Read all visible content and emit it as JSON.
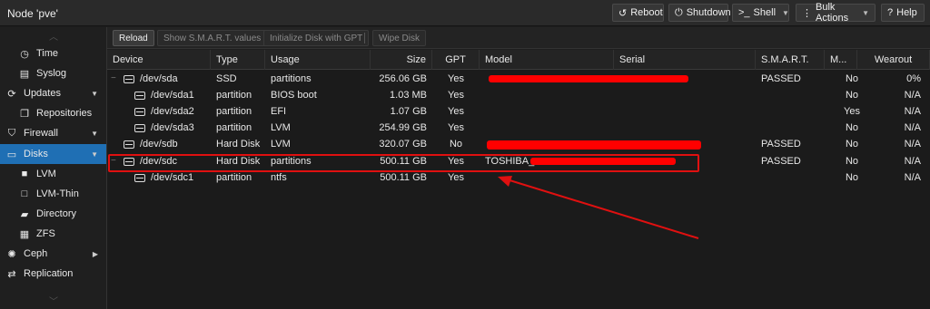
{
  "titlebar": {
    "title": "Node 'pve'",
    "buttons": [
      {
        "label": "Reboot",
        "icon": "reload-icon",
        "glyph": "↺",
        "dropdown": false
      },
      {
        "label": "Shutdown",
        "icon": "power-icon",
        "glyph": "⏻",
        "dropdown": false
      },
      {
        "label": "Shell",
        "icon": "terminal-icon",
        "glyph": ">_",
        "dropdown": true
      },
      {
        "label": "Bulk Actions",
        "icon": "list-icon",
        "glyph": "⋮",
        "dropdown": true
      },
      {
        "label": "Help",
        "icon": "help-icon",
        "glyph": "?",
        "dropdown": false
      }
    ]
  },
  "sidebar": {
    "items": [
      {
        "label": "Time",
        "icon": "clock-icon",
        "glyph": "◷",
        "indent": 1,
        "selected": false,
        "expander": false
      },
      {
        "label": "Syslog",
        "icon": "list-icon",
        "glyph": "▤",
        "indent": 1,
        "selected": false,
        "expander": false
      },
      {
        "label": "Updates",
        "icon": "refresh-icon",
        "glyph": "⟳",
        "indent": 0,
        "selected": false,
        "expander": true
      },
      {
        "label": "Repositories",
        "icon": "files-icon",
        "glyph": "❐",
        "indent": 1,
        "selected": false,
        "expander": false
      },
      {
        "label": "Firewall",
        "icon": "shield-icon",
        "glyph": "⛉",
        "indent": 0,
        "selected": false,
        "expander": true
      },
      {
        "label": "Disks",
        "icon": "disk-icon",
        "glyph": "▭",
        "indent": 0,
        "selected": true,
        "expander": true
      },
      {
        "label": "LVM",
        "icon": "square-icon",
        "glyph": "■",
        "indent": 1,
        "selected": false,
        "expander": false
      },
      {
        "label": "LVM-Thin",
        "icon": "square-outline-icon",
        "glyph": "□",
        "indent": 1,
        "selected": false,
        "expander": false
      },
      {
        "label": "Directory",
        "icon": "folder-icon",
        "glyph": "▰",
        "indent": 1,
        "selected": false,
        "expander": false
      },
      {
        "label": "ZFS",
        "icon": "database-icon",
        "glyph": "▦",
        "indent": 1,
        "selected": false,
        "expander": false
      },
      {
        "label": "Ceph",
        "icon": "ceph-icon",
        "glyph": "✺",
        "indent": 0,
        "selected": false,
        "expander": true
      },
      {
        "label": "Replication",
        "icon": "replication-icon",
        "glyph": "⇄",
        "indent": 0,
        "selected": false,
        "expander": false
      }
    ]
  },
  "toolbar": {
    "buttons": [
      {
        "label": "Reload",
        "enabled": true
      },
      {
        "label": "Show S.M.A.R.T. values",
        "enabled": false
      },
      {
        "label": "Initialize Disk with GPT",
        "enabled": false
      },
      {
        "label": "Wipe Disk",
        "enabled": false
      }
    ]
  },
  "table": {
    "columns": [
      "Device",
      "Type",
      "Usage",
      "Size",
      "GPT",
      "Model",
      "Serial",
      "S.M.A.R.T.",
      "M...",
      "Wearout"
    ],
    "rows": [
      {
        "device": "/dev/sda",
        "level": 0,
        "tree": "−",
        "type": "SSD",
        "usage": "partitions",
        "size": "256.06 GB",
        "gpt": "Yes",
        "model": "",
        "serial": "",
        "smart": "PASSED",
        "mounted": "No",
        "wearout": "0%"
      },
      {
        "device": "/dev/sda1",
        "level": 1,
        "tree": "",
        "type": "partition",
        "usage": "BIOS boot",
        "size": "1.03 MB",
        "gpt": "Yes",
        "model": "",
        "serial": "",
        "smart": "",
        "mounted": "No",
        "wearout": "N/A"
      },
      {
        "device": "/dev/sda2",
        "level": 1,
        "tree": "",
        "type": "partition",
        "usage": "EFI",
        "size": "1.07 GB",
        "gpt": "Yes",
        "model": "",
        "serial": "",
        "smart": "",
        "mounted": "Yes",
        "wearout": "N/A"
      },
      {
        "device": "/dev/sda3",
        "level": 1,
        "tree": "",
        "type": "partition",
        "usage": "LVM",
        "size": "254.99 GB",
        "gpt": "Yes",
        "model": "",
        "serial": "",
        "smart": "",
        "mounted": "No",
        "wearout": "N/A"
      },
      {
        "device": "/dev/sdb",
        "level": 0,
        "tree": "",
        "type": "Hard Disk",
        "usage": "LVM",
        "size": "320.07 GB",
        "gpt": "No",
        "model": "",
        "serial": "",
        "smart": "PASSED",
        "mounted": "No",
        "wearout": "N/A"
      },
      {
        "device": "/dev/sdc",
        "level": 0,
        "tree": "−",
        "type": "Hard Disk",
        "usage": "partitions",
        "size": "500.11 GB",
        "gpt": "Yes",
        "model": "TOSHIBA_",
        "serial": "",
        "smart": "PASSED",
        "mounted": "No",
        "wearout": "N/A"
      },
      {
        "device": "/dev/sdc1",
        "level": 1,
        "tree": "",
        "type": "partition",
        "usage": "ntfs",
        "size": "500.11 GB",
        "gpt": "Yes",
        "model": "",
        "serial": "",
        "smart": "",
        "mounted": "No",
        "wearout": "N/A"
      }
    ]
  },
  "colors": {
    "accent": "#1f6fb4",
    "annotation_red": "#e01010",
    "redaction_red": "#ff0000"
  }
}
